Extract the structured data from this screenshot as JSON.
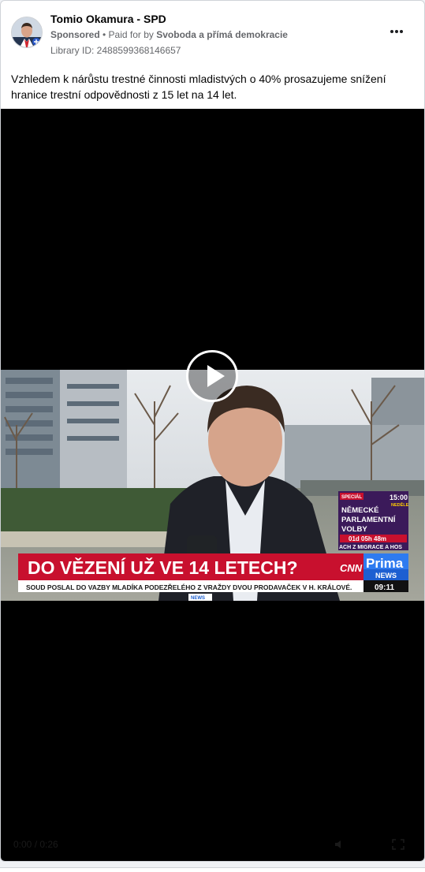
{
  "post": {
    "page_name": "Tomio Okamura - SPD",
    "sponsored_label": "Sponsored",
    "paid_prefix": " • Paid for by ",
    "payer": "Svoboda a přímá demokracie",
    "library_id": "Library ID: 2488599368146657",
    "body": "Vzhledem k nárůstu trestné činnosti mladistvých o 40% prosazujeme snížení hranice trestní odpovědnosti z 15 let na 14 let."
  },
  "video": {
    "headline": "DO VĚZENÍ UŽ VE 14 LETECH?",
    "ticker": "SOUD POSLAL DO VAZBY MLADÍKA PODEZŘELÉHO Z VRAŽDY DVOU PRODAVAČEK V H. KRÁLOVÉ.",
    "cnn_logo": "CNN",
    "prima_logo": "Prima",
    "news_logo": "NEWS",
    "clock": "09:11",
    "promo": {
      "special": "SPECIÁL",
      "time": "15:00",
      "day": "NEDĚLE",
      "line1": "NĚMECKÉ",
      "line2": "PARLAMENTNÍ",
      "line3": "VOLBY",
      "countdown": "01d 05h 48m",
      "bottom": "ACH Z MIGRACE A HOS"
    },
    "mic_label": "NEWS",
    "controls_time": "0:00 / 0:26"
  },
  "colors": {
    "banner_red": "#c8102e",
    "prima_blue": "#1d5fd1",
    "promo_purple": "#3b1a5a"
  }
}
